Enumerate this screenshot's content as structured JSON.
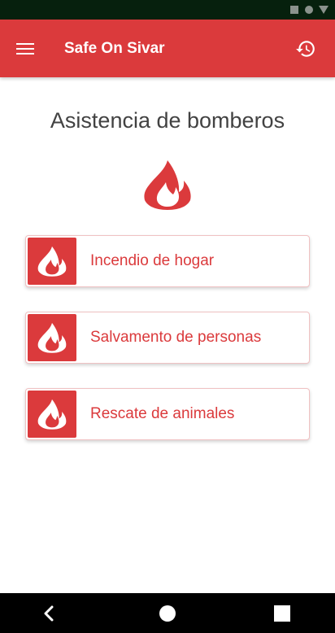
{
  "app": {
    "title": "Safe On Sivar",
    "accent_color": "#db3a3c",
    "menu_icon": "hamburger-menu-icon",
    "history_icon": "history-icon"
  },
  "main": {
    "title": "Asistencia de bomberos",
    "hero_icon": "fire-icon"
  },
  "options": [
    {
      "label": "Incendio de hogar",
      "icon": "fire-icon"
    },
    {
      "label": "Salvamento de personas",
      "icon": "fire-icon"
    },
    {
      "label": "Rescate de animales",
      "icon": "fire-icon"
    }
  ],
  "system_nav": {
    "back_icon": "back-icon",
    "home_icon": "home-icon",
    "recents_icon": "recents-icon"
  }
}
